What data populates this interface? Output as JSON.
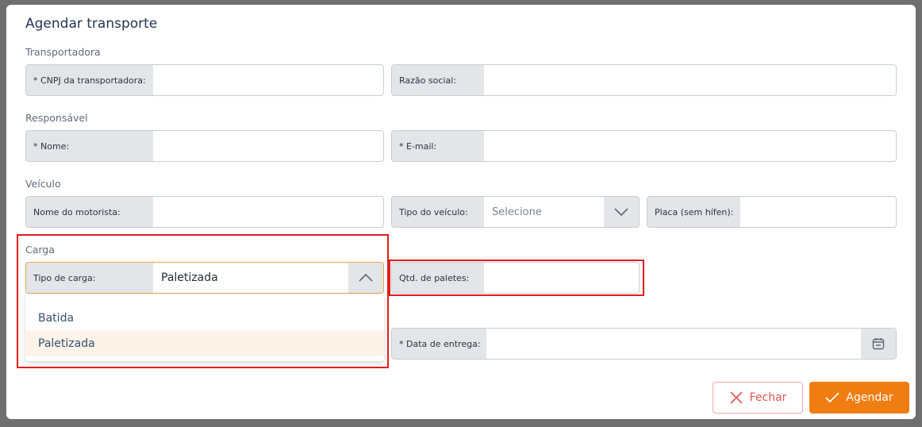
{
  "modal": {
    "title": "Agendar transporte",
    "sections": {
      "transportadora": "Transportadora",
      "responsavel": "Responsável",
      "veiculo": "Veículo",
      "carga": "Carga"
    }
  },
  "fields": {
    "cnpj": {
      "label": "* CNPJ da transportadora:",
      "value": ""
    },
    "razao_social": {
      "label": "Razão social:",
      "value": ""
    },
    "nome": {
      "label": "* Nome:",
      "value": ""
    },
    "email": {
      "label": "* E-mail:",
      "value": ""
    },
    "nome_motorista": {
      "label": "Nome do motorista:",
      "value": ""
    },
    "tipo_veiculo": {
      "label": "Tipo do veículo:",
      "value": "Selecione"
    },
    "placa": {
      "label": "Placa (sem hífen):",
      "value": ""
    },
    "tipo_carga": {
      "label": "Tipo de carga:",
      "value": "Paletizada"
    },
    "qtd_paletes": {
      "label": "Qtd. de paletes:",
      "value": ""
    },
    "data_entrega": {
      "label": "* Data de entrega:",
      "value": ""
    }
  },
  "dropdown": {
    "options": [
      "Batida",
      "Paletizada"
    ],
    "selected": "Paletizada"
  },
  "buttons": {
    "close": "Fechar",
    "schedule": "Agendar"
  },
  "colors": {
    "accent": "#f07d11",
    "danger": "#e0574f",
    "highlight_box": "#e11d1d",
    "focus_border": "#e8a64b"
  }
}
